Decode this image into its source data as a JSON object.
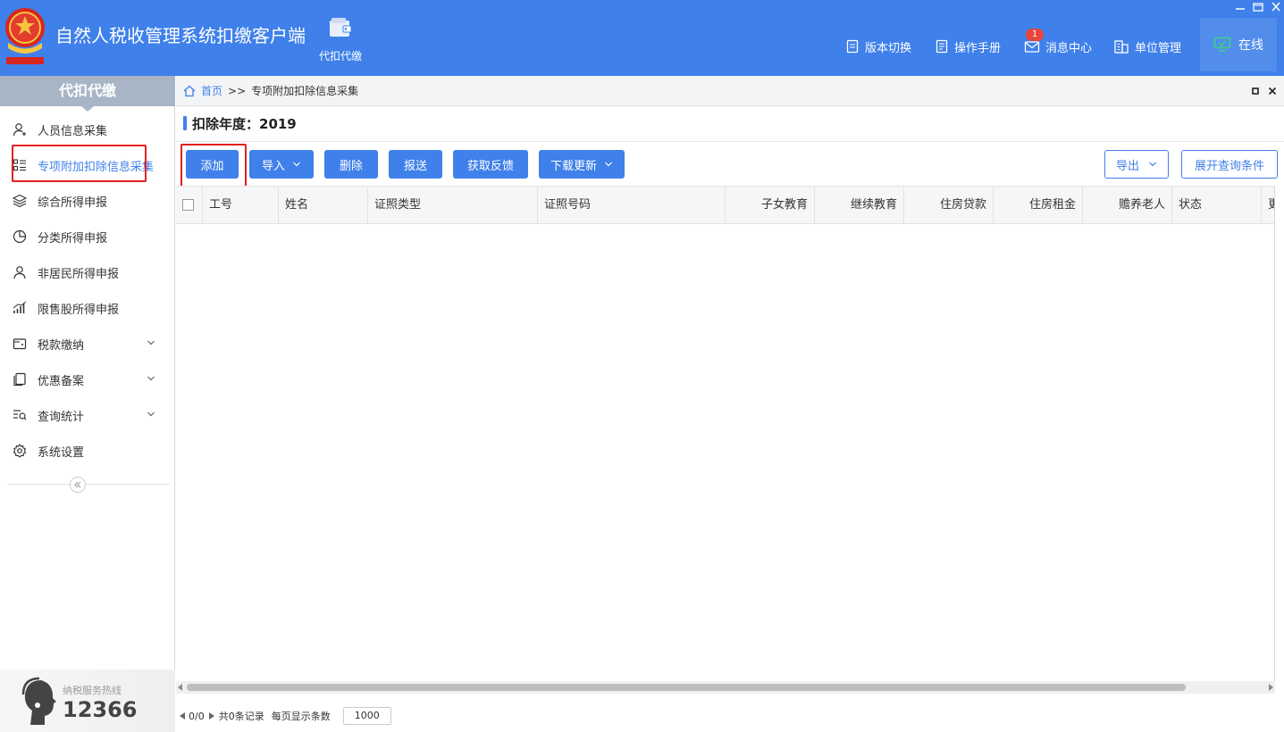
{
  "app": {
    "title": "自然人税收管理系统扣缴客户端",
    "module_tab_label": "代扣代缴",
    "nav": [
      {
        "label": "版本切换",
        "icon": "document-icon"
      },
      {
        "label": "操作手册",
        "icon": "manual-icon"
      },
      {
        "label": "消息中心",
        "icon": "mail-icon",
        "badge": "1"
      },
      {
        "label": "单位管理",
        "icon": "building-icon"
      }
    ],
    "status": "在线",
    "colors": {
      "brand": "#3f80ea",
      "badge": "#e8453c",
      "highlight": "#e32020",
      "online": "#3ed37c"
    }
  },
  "sidebar": {
    "title": "代扣代缴",
    "items": [
      {
        "label": "人员信息采集",
        "icon": "user-add-icon",
        "expandable": false
      },
      {
        "label": "专项附加扣除信息采集",
        "icon": "list-icon",
        "expandable": false,
        "active": true
      },
      {
        "label": "综合所得申报",
        "icon": "layers-icon",
        "expandable": false
      },
      {
        "label": "分类所得申报",
        "icon": "pie-icon",
        "expandable": false
      },
      {
        "label": "非居民所得申报",
        "icon": "person-icon",
        "expandable": false
      },
      {
        "label": "限售股所得申报",
        "icon": "bar-chart-icon",
        "expandable": false
      },
      {
        "label": "税款缴纳",
        "icon": "wallet-icon",
        "expandable": true
      },
      {
        "label": "优惠备案",
        "icon": "copy-icon",
        "expandable": true
      },
      {
        "label": "查询统计",
        "icon": "search-list-icon",
        "expandable": true
      },
      {
        "label": "系统设置",
        "icon": "gear-icon",
        "expandable": false
      }
    ],
    "hotline_label": "纳税服务热线",
    "hotline_number": "12366"
  },
  "breadcrumb": {
    "home": "首页",
    "separator": ">>",
    "current": "专项附加扣除信息采集"
  },
  "section": {
    "title": "扣除年度：2019"
  },
  "toolbar": {
    "add": "添加",
    "import": "导入",
    "delete": "删除",
    "submit": "报送",
    "feedback": "获取反馈",
    "download": "下载更新",
    "export": "导出",
    "expand_query": "展开查询条件"
  },
  "table": {
    "columns": [
      "工号",
      "姓名",
      "证照类型",
      "证照号码",
      "子女教育",
      "继续教育",
      "住房贷款",
      "住房租金",
      "赡养老人",
      "状态",
      "更"
    ],
    "rows": []
  },
  "pager": {
    "page": "0/0",
    "total": "共0条记录",
    "per_page_label": "每页显示条数",
    "per_page_value": "1000"
  }
}
